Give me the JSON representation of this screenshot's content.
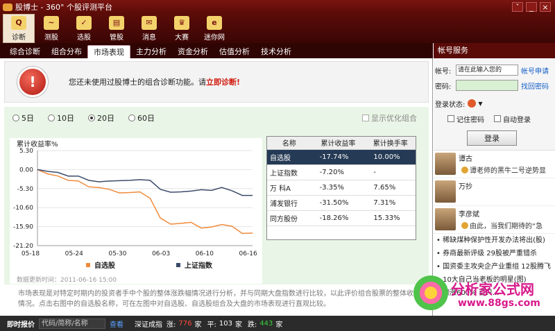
{
  "window": {
    "title": "股博士 - 360° 个股评测平台",
    "controls": [
      "ˇ",
      "_",
      "×"
    ]
  },
  "toolbar": [
    {
      "label": "诊断",
      "icon": "magnifier-icon",
      "glyph": "Q",
      "active": true
    },
    {
      "label": "测股",
      "icon": "line-chart-icon",
      "glyph": "~"
    },
    {
      "label": "选股",
      "icon": "checklist-icon",
      "glyph": "✓"
    },
    {
      "label": "管股",
      "icon": "portfolio-icon",
      "glyph": "▤"
    },
    {
      "label": "消息",
      "icon": "message-icon",
      "glyph": "✉"
    },
    {
      "label": "大赛",
      "icon": "contest-icon",
      "glyph": "♛"
    },
    {
      "label": "迷你网",
      "icon": "browser-icon",
      "glyph": "e"
    }
  ],
  "tabs": [
    "综合诊断",
    "组合分布",
    "市场表现",
    "主力分析",
    "资金分析",
    "估值分析",
    "技术分析"
  ],
  "active_tab": "市场表现",
  "alert": {
    "text": "您还未使用过股博士的组合诊断功能。请",
    "link": "立即诊断",
    "suffix": "!"
  },
  "periods": [
    {
      "label": "5日"
    },
    {
      "label": "10日"
    },
    {
      "label": "20日",
      "selected": true
    },
    {
      "label": "60日"
    }
  ],
  "optimize_label": "显示优化组合",
  "table": {
    "headers": [
      "名称",
      "累计收益率",
      "累计换手率"
    ],
    "rows": [
      [
        "自选股",
        "-17.74%",
        "10.00%"
      ],
      [
        "上证指数",
        "-7.20%",
        "-"
      ],
      [
        "万 科A",
        "-3.35%",
        "7.65%"
      ],
      [
        "浦发银行",
        "-31.50%",
        "7.31%"
      ],
      [
        "同方股份",
        "-18.26%",
        "15.33%"
      ]
    ]
  },
  "chart_data": {
    "type": "line",
    "ylabel": "累计收益率%",
    "y_ticks": [
      "5.30",
      "0.00",
      "-5.30",
      "-10.60",
      "-15.90",
      "-21.20"
    ],
    "ylim": [
      -21.2,
      5.3
    ],
    "x_ticks": [
      "05-18",
      "05-24",
      "05-30",
      "06-03",
      "06-10",
      "06-16"
    ],
    "series": [
      {
        "name": "自选股",
        "color": "#f08a3a",
        "values": [
          0.0,
          -1.2,
          -1.8,
          -3.0,
          -3.2,
          -4.8,
          -5.0,
          -5.5,
          -6.5,
          -6.4,
          -6.2,
          -8.0,
          -13.5,
          -15.2,
          -15.0,
          -14.7,
          -16.3,
          -16.0,
          -15.3,
          -15.8,
          -17.8,
          -17.7
        ]
      },
      {
        "name": "上证指数",
        "color": "#3c4a6a",
        "values": [
          0.0,
          -0.5,
          -0.8,
          -1.8,
          -1.8,
          -3.0,
          -3.4,
          -3.2,
          -3.1,
          -3.0,
          -2.8,
          -3.0,
          -5.5,
          -6.3,
          -6.2,
          -6.0,
          -5.6,
          -5.8,
          -5.0,
          -5.9,
          -7.2,
          -7.2
        ]
      }
    ],
    "legend": [
      "自选股",
      "上证指数"
    ]
  },
  "update_time": "数据更新时间：2011-06-16 15:00",
  "note": "市场表现是对特定时期内的投资者手中个股的整体涨跌幅情况进行分析，并与同期大盘指数进行比较，以此评价组合股票的整体收益率情况。点击右图中的自选股名称，可在左图中对自选股、自选股组合及大盘的市场表现进行直观比较。",
  "right": {
    "header": "帐号服务",
    "account_label": "帐号:",
    "account_placeholder": "请在此输入您的",
    "apply_link": "帐号申请",
    "password_label": "密码:",
    "recover_link": "找回密码",
    "status_label": "登录状态:",
    "remember": "记住密码",
    "auto_login": "自动登录",
    "login_button": "登录",
    "experts": [
      {
        "name": "谭古",
        "text": "谭老师的黑牛二号逆势显"
      },
      {
        "name": "万抄",
        "text": ""
      },
      {
        "name": "李彦斌",
        "text": "由此，当我们期待的“急"
      }
    ],
    "news": [
      "稀缺煤种保护性开发办法将出(股)",
      "券商最新评级  29股被严重错杀",
      "国资委主攻央企产业重组  12股腾飞",
      "10大自己当老板的明星(图)",
      "领涨600%  百只..."
    ]
  },
  "bottom": {
    "quote_label": "即时报价",
    "search_placeholder": "代码/简称/名称",
    "search_btn": "查看",
    "index_name": "深证成指",
    "up_label": "涨:",
    "up": "776",
    "flat_label": "平:",
    "flat": "103",
    "down_label": "跌:",
    "down": "443",
    "unit": "家"
  },
  "watermark": {
    "brand": "分析家公式网",
    "url": "www.88gs.com"
  }
}
